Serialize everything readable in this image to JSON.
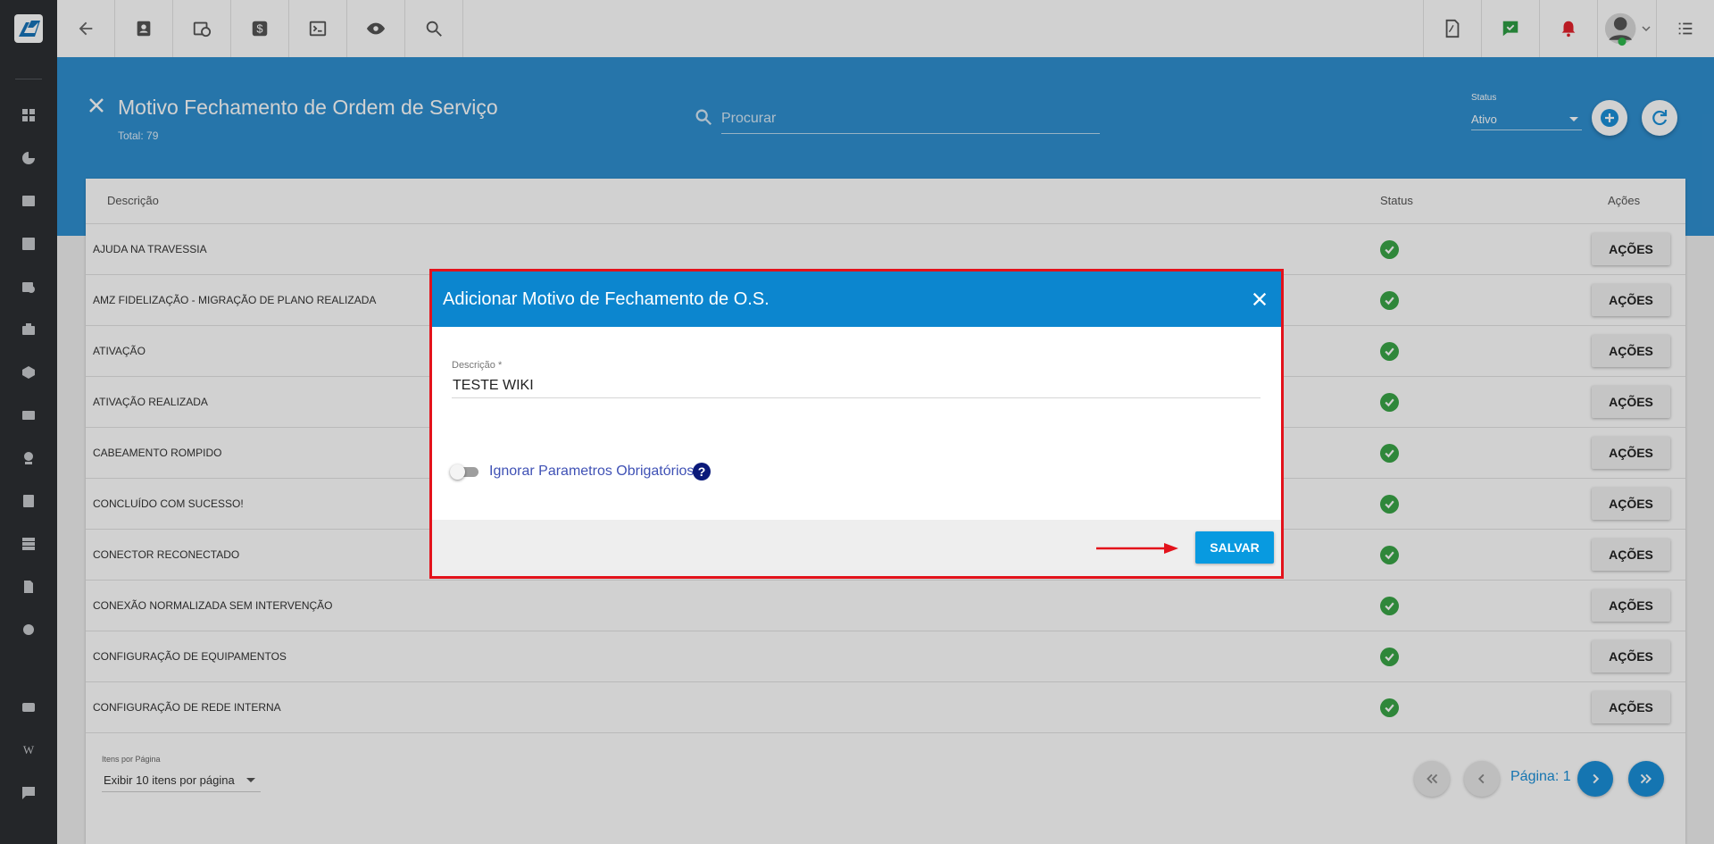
{
  "header": {
    "title": "Motivo Fechamento de Ordem de Serviço",
    "total": "Total: 79",
    "search_placeholder": "Procurar",
    "status_label": "Status",
    "status_value": "Ativo"
  },
  "table": {
    "columns": [
      "Descrição",
      "Status",
      "Ações"
    ],
    "action_label": "AÇÕES",
    "rows": [
      {
        "descricao": "AJUDA NA TRAVESSIA",
        "status": "ativo"
      },
      {
        "descricao": "AMZ FIDELIZAÇÃO - MIGRAÇÃO DE PLANO REALIZADA",
        "status": "ativo"
      },
      {
        "descricao": "ATIVAÇÃO",
        "status": "ativo"
      },
      {
        "descricao": "ATIVAÇÃO REALIZADA",
        "status": "ativo"
      },
      {
        "descricao": "CABEAMENTO ROMPIDO",
        "status": "ativo"
      },
      {
        "descricao": "CONCLUÍDO COM SUCESSO!",
        "status": "ativo"
      },
      {
        "descricao": "CONECTOR RECONECTADO",
        "status": "ativo"
      },
      {
        "descricao": "CONEXÃO NORMALIZADA SEM INTERVENÇÃO",
        "status": "ativo"
      },
      {
        "descricao": "CONFIGURAÇÃO DE EQUIPAMENTOS",
        "status": "ativo"
      },
      {
        "descricao": "CONFIGURAÇÃO DE REDE INTERNA",
        "status": "ativo"
      }
    ]
  },
  "pagination": {
    "per_page_label": "Itens por Página",
    "per_page_value": "Exibir 10 itens por página",
    "page_text": "Página: 1"
  },
  "modal": {
    "title": "Adicionar Motivo de Fechamento de O.S.",
    "field_label": "Descrição *",
    "field_value": "TESTE WIKI",
    "toggle_label": "Ignorar Parametros Obrigatórios",
    "help_glyph": "?",
    "save_label": "SALVAR"
  },
  "colors": {
    "brand_blue": "#2f8fd0",
    "modal_header": "#0c86cf",
    "highlight_border": "#e3121b",
    "status_ok": "#3aa547"
  }
}
